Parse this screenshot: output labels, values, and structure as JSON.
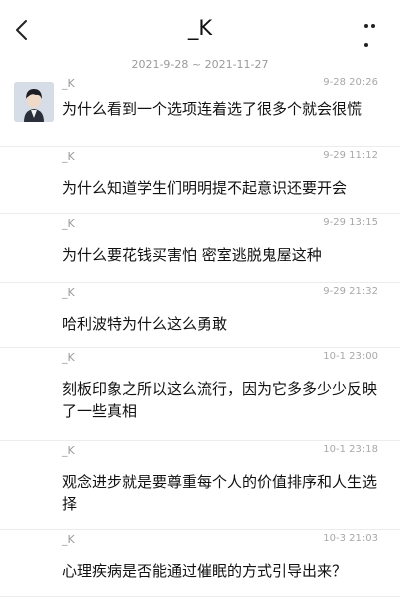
{
  "header": {
    "title": "_K"
  },
  "date_range": "2021-9-28 ~ 2021-11-27",
  "messages": [
    {
      "name": "_K",
      "time": "9-28 20:26",
      "text": "为什么看到一个选项连着选了很多个就会很慌"
    },
    {
      "name": "_K",
      "time": "9-29 11:12",
      "text": "为什么知道学生们明明提不起意识还要开会"
    },
    {
      "name": "_K",
      "time": "9-29 13:15",
      "text": "为什么要花钱买害怕 密室逃脱鬼屋这种"
    },
    {
      "name": "_K",
      "time": "9-29 21:32",
      "text": "哈利波特为什么这么勇敢"
    },
    {
      "name": "_K",
      "time": "10-1 23:00",
      "text": "刻板印象之所以这么流行，因为它多多少少反映了一些真相"
    },
    {
      "name": "_K",
      "time": "10-1 23:18",
      "text": "观念进步就是要尊重每个人的价值排序和人生选择"
    },
    {
      "name": "_K",
      "time": "10-3 21:03",
      "text": "心理疾病是否能通过催眠的方式引导出来？"
    }
  ]
}
